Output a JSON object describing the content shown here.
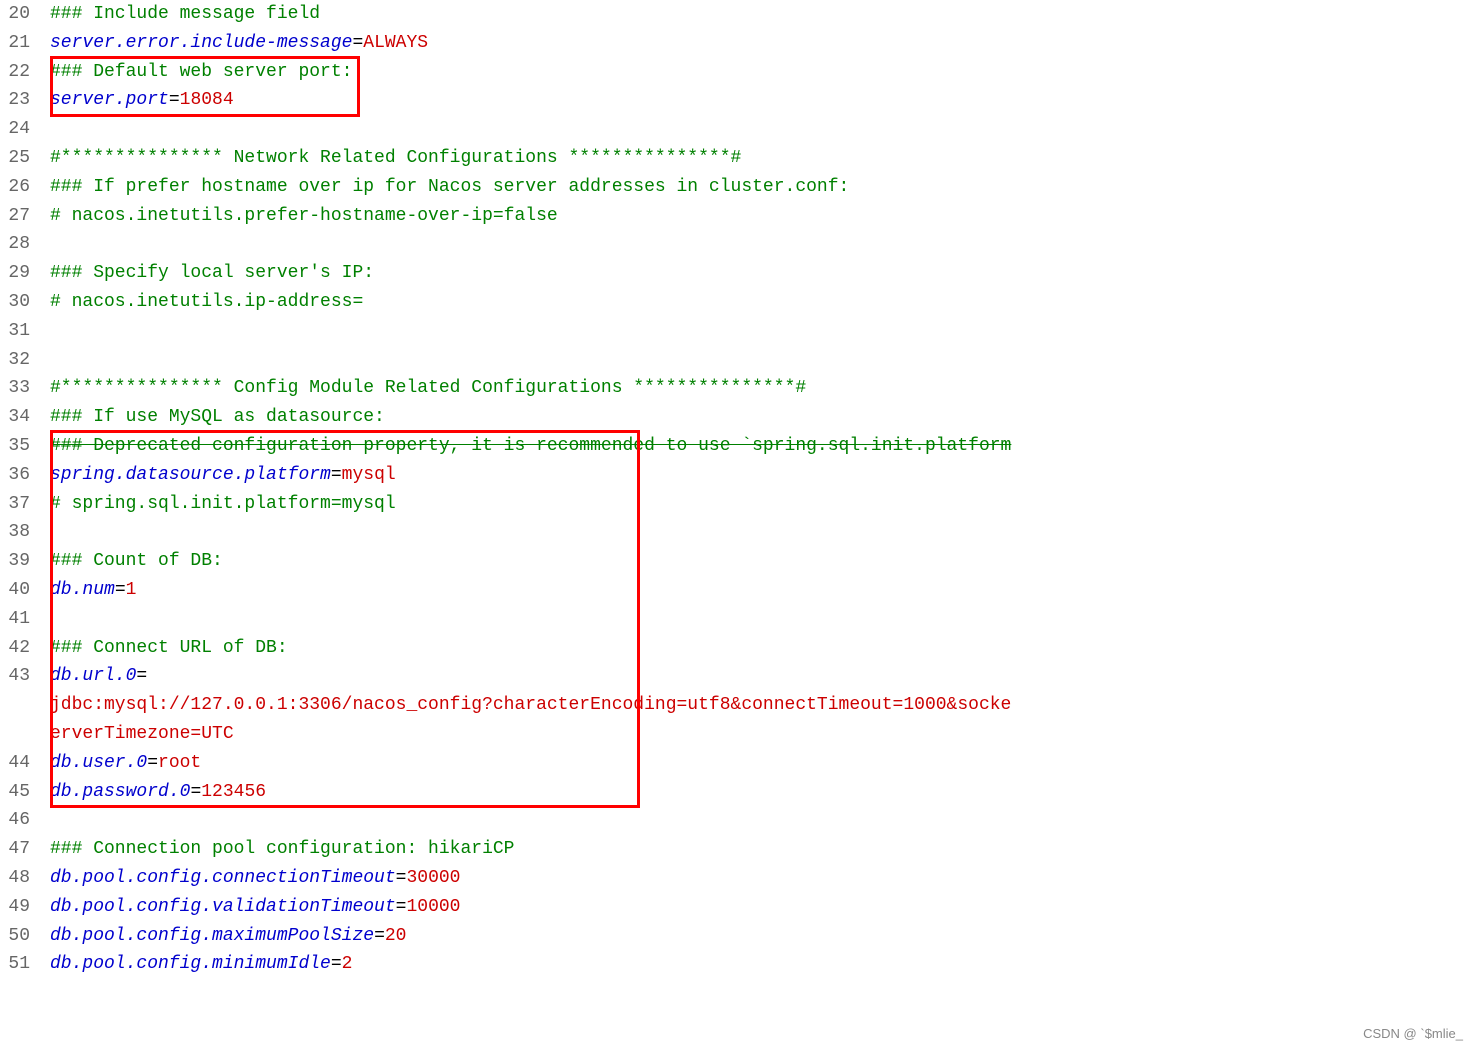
{
  "lines": [
    {
      "num": 20,
      "parts": [
        {
          "text": "### Include message field",
          "class": "c-comment"
        }
      ]
    },
    {
      "num": 21,
      "parts": [
        {
          "text": "server.error.include-message",
          "class": "c-key"
        },
        {
          "text": "=",
          "class": "c-eq"
        },
        {
          "text": "ALWAYS",
          "class": "c-val"
        }
      ]
    },
    {
      "num": 22,
      "parts": [
        {
          "text": "### Default web server port:",
          "class": "c-comment"
        }
      ]
    },
    {
      "num": 23,
      "parts": [
        {
          "text": "server.port",
          "class": "c-key"
        },
        {
          "text": "=",
          "class": "c-eq"
        },
        {
          "text": "18084",
          "class": "c-val"
        }
      ]
    },
    {
      "num": 24,
      "parts": []
    },
    {
      "num": 25,
      "parts": [
        {
          "text": "#*************** Network Related Configurations ***************#",
          "class": "c-comment"
        }
      ]
    },
    {
      "num": 26,
      "parts": [
        {
          "text": "### If prefer hostname over ip for Nacos server addresses in cluster.conf:",
          "class": "c-comment"
        }
      ]
    },
    {
      "num": 27,
      "parts": [
        {
          "text": "# nacos.inetutils.prefer-hostname-over-ip=false",
          "class": "c-comment"
        }
      ]
    },
    {
      "num": 28,
      "parts": []
    },
    {
      "num": 29,
      "parts": [
        {
          "text": "### Specify local server's IP:",
          "class": "c-comment"
        }
      ]
    },
    {
      "num": 30,
      "parts": [
        {
          "text": "# nacos.inetutils.ip-address=",
          "class": "c-comment"
        }
      ]
    },
    {
      "num": 31,
      "parts": []
    },
    {
      "num": 32,
      "parts": []
    },
    {
      "num": 33,
      "parts": [
        {
          "text": "#*************** Config Module Related Configurations ***************#",
          "class": "c-comment"
        }
      ]
    },
    {
      "num": 34,
      "parts": [
        {
          "text": "### If use MySQL as datasource:",
          "class": "c-comment"
        }
      ]
    },
    {
      "num": 35,
      "parts": [
        {
          "text": "### Deprecated configuration property, it is recommended to use `spring.sql.init.platform",
          "class": "c-comment c-strike"
        }
      ]
    },
    {
      "num": 36,
      "parts": [
        {
          "text": "spring.datasource.platform",
          "class": "c-key"
        },
        {
          "text": "=",
          "class": "c-eq"
        },
        {
          "text": "mysql",
          "class": "c-val"
        }
      ]
    },
    {
      "num": 37,
      "parts": [
        {
          "text": "# spring.sql.init.platform=mysql",
          "class": "c-comment"
        }
      ]
    },
    {
      "num": 38,
      "parts": []
    },
    {
      "num": 39,
      "parts": [
        {
          "text": "### Count of DB:",
          "class": "c-comment"
        }
      ]
    },
    {
      "num": 40,
      "parts": [
        {
          "text": "db.num",
          "class": "c-key"
        },
        {
          "text": "=",
          "class": "c-eq"
        },
        {
          "text": "1",
          "class": "c-val"
        }
      ]
    },
    {
      "num": 41,
      "parts": []
    },
    {
      "num": 42,
      "parts": [
        {
          "text": "### Connect URL of DB:",
          "class": "c-comment"
        }
      ]
    },
    {
      "num": 43,
      "parts": [
        {
          "text": "db.url.0",
          "class": "c-key"
        },
        {
          "text": "=",
          "class": "c-eq"
        }
      ]
    },
    {
      "num": 43.5,
      "parts": [
        {
          "text": "jdbc:mysql://127.0.0.1:3306/nacos_config?characterEncoding=utf8&connectTimeout=1000&socke",
          "class": "c-val"
        }
      ],
      "nonum": true,
      "indent": true
    },
    {
      "num": 43.6,
      "parts": [
        {
          "text": "erverTimezone=UTC",
          "class": "c-val"
        }
      ],
      "nonum": true,
      "indent": true
    },
    {
      "num": 44,
      "parts": [
        {
          "text": "db.user.0",
          "class": "c-key"
        },
        {
          "text": "=",
          "class": "c-eq"
        },
        {
          "text": "root",
          "class": "c-val"
        }
      ]
    },
    {
      "num": 45,
      "parts": [
        {
          "text": "db.password.0",
          "class": "c-key"
        },
        {
          "text": "=",
          "class": "c-eq"
        },
        {
          "text": "123456",
          "class": "c-val"
        }
      ]
    },
    {
      "num": 46,
      "parts": []
    },
    {
      "num": 47,
      "parts": [
        {
          "text": "### Connection pool configuration: hikariCP",
          "class": "c-comment"
        }
      ]
    },
    {
      "num": 48,
      "parts": [
        {
          "text": "db.pool.config.connectionTimeout",
          "class": "c-key"
        },
        {
          "text": "=",
          "class": "c-eq"
        },
        {
          "text": "30000",
          "class": "c-val"
        }
      ]
    },
    {
      "num": 49,
      "parts": [
        {
          "text": "db.pool.config.validationTimeout",
          "class": "c-key"
        },
        {
          "text": "=",
          "class": "c-eq"
        },
        {
          "text": "10000",
          "class": "c-val"
        }
      ]
    },
    {
      "num": 50,
      "parts": [
        {
          "text": "db.pool.config.maximumPoolSize",
          "class": "c-key"
        },
        {
          "text": "=",
          "class": "c-eq"
        },
        {
          "text": "20",
          "class": "c-val"
        }
      ]
    },
    {
      "num": 51,
      "parts": [
        {
          "text": "db.pool.config.minimumIdle",
          "class": "c-key"
        },
        {
          "text": "=",
          "class": "c-eq"
        },
        {
          "text": "2",
          "class": "c-val"
        }
      ]
    }
  ],
  "watermark": "CSDN @ `$mlie_",
  "redbox1": {
    "label": "server port highlight"
  },
  "redbox2": {
    "label": "datasource highlight"
  }
}
